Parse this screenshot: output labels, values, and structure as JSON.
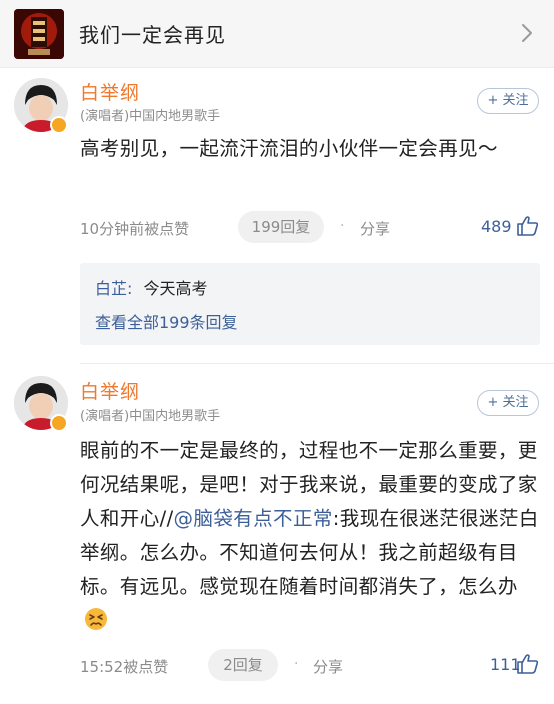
{
  "song": {
    "title": "我们一定会再见",
    "cover_icon": "album-cover",
    "chevron_icon": "chevron-right-icon"
  },
  "comments": [
    {
      "username": "白举纲",
      "tag": "(演唱者)中国内地男歌手",
      "follow_label": "+ 关注",
      "text": "高考别见，一起流汗流泪的小伙伴一定会再见～",
      "time": "10分钟前被点赞",
      "reply_count_label": "199回复",
      "share_label": "分享",
      "likes": "489",
      "reply": {
        "author": "白芷:",
        "text": "今天高考",
        "view_all": "查看全部199条回复"
      }
    },
    {
      "username": "白举纲",
      "tag": "(演唱者)中国内地男歌手",
      "follow_label": "+ 关注",
      "text_before": "眼前的不一定是最终的，过程也不一定那么重要，更何况结果呢，是吧！对于我来说，最重要的变成了家人和开心//",
      "mention": "@脑袋有点不正常",
      "text_after": ":我现在很迷茫很迷茫白举纲。怎么办。不知道何去何从！我之前超级有目标。有远见。感觉现在随着时间都消失了，怎么办",
      "emoji": "frustrated-face-emoji",
      "time": "15:52被点赞",
      "reply_count_label": "2回复",
      "share_label": "分享",
      "likes": "111"
    }
  ],
  "colors": {
    "username": "#f0782d",
    "link": "#3d5f99",
    "badge": "#f5a623"
  }
}
